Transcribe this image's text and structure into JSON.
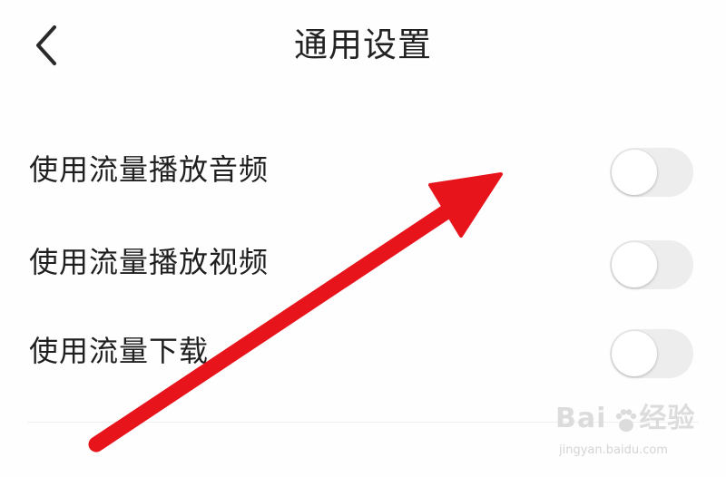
{
  "header": {
    "back_icon": "chevron-left-icon",
    "title": "通用设置"
  },
  "settings": {
    "items": [
      {
        "label": "使用流量播放音频",
        "enabled": false
      },
      {
        "label": "使用流量播放视频",
        "enabled": false
      },
      {
        "label": "使用流量下载",
        "enabled": false
      }
    ]
  },
  "annotation": {
    "type": "arrow",
    "color": "#e8141b",
    "icon": "red-arrow-annotation"
  },
  "watermark": {
    "brand_left": "Bai",
    "brand_right": "经验",
    "url": "jingyan.baidu.com"
  },
  "colors": {
    "background": "#fefefe",
    "text": "#1f1f1f",
    "toggle_off_track": "#ededed",
    "toggle_knob": "#ffffff"
  }
}
